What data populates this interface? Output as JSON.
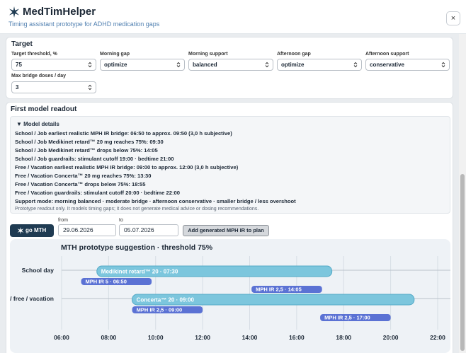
{
  "app": {
    "title": "MedTimHelper",
    "subtitle": "Timing assistant prototype for ADHD medication gaps",
    "close_label": "×"
  },
  "target": {
    "title": "Target",
    "fields": [
      {
        "label": "Target threshold, %",
        "value": "75"
      },
      {
        "label": "Morning gap",
        "value": "optimize"
      },
      {
        "label": "Morning support",
        "value": "balanced"
      },
      {
        "label": "Afternoon gap",
        "value": "optimize"
      },
      {
        "label": "Afternoon support",
        "value": "conservative"
      }
    ],
    "max_bridge": {
      "label": "Max bridge doses / day",
      "value": "3"
    }
  },
  "readout": {
    "title": "First model readout",
    "details_summary": "▼ Model details",
    "lines": [
      "School / Job earliest realistic MPH IR bridge: 06:50 to approx. 09:50 (3,0 h subjective)",
      "School / Job Medikinet retard™ 20 mg reaches 75%: 09:30",
      "School / Job Medikinet retard™ drops below 75%: 14:05",
      "School / Job guardrails: stimulant cutoff 19:00 · bedtime 21:00",
      "Free / Vacation earliest realistic MPH IR bridge: 09:00 to approx. 12:00 (3,0 h subjective)",
      "Free / Vacation Concerta™ 20 mg reaches 75%: 13:30",
      "Free / Vacation Concerta™ drops below 75%: 18:55",
      "Free / Vacation guardrails: stimulant cutoff 20:00 · bedtime 22:00",
      "Support mode: morning balanced · moderate bridge · afternoon conservative · smaller bridge / less overshoot"
    ],
    "note": "Prototype readout only. It models timing gaps; it does not generate medical advice or dosing recommendations."
  },
  "actions": {
    "go_label": "go MTH",
    "from_label": "from",
    "from_value": "29.06.2026",
    "to_label": "to",
    "to_value": "05.07.2026",
    "add_label": "Add generated MPH IR to plan"
  },
  "chart_data": {
    "type": "timeline",
    "title": "MTH prototype suggestion · threshold 75%",
    "rows": [
      "School day",
      "/ free / vacation"
    ],
    "x_ticks": [
      "06:00",
      "08:00",
      "10:00",
      "12:00",
      "14:00",
      "16:00",
      "18:00",
      "20:00",
      "22:00"
    ],
    "x_range_hours": [
      6,
      22
    ],
    "bars": [
      {
        "row": 0,
        "label": "Medikinet retard™ 20 · 07:30",
        "start": 7.5,
        "end": 17.5,
        "kind": "retard"
      },
      {
        "row": 0,
        "label": "MPH IR 5 · 06:50",
        "start": 6.83,
        "end": 9.83,
        "kind": "ir"
      },
      {
        "row": 0,
        "label": "MPH IR 2,5 · 14:05",
        "start": 14.08,
        "end": 17.08,
        "kind": "ir"
      },
      {
        "row": 1,
        "label": "Concerta™ 20 · 09:00",
        "start": 9.0,
        "end": 21.0,
        "kind": "retard"
      },
      {
        "row": 1,
        "label": "MPH IR 2,5 · 09:00",
        "start": 9.0,
        "end": 12.0,
        "kind": "ir"
      },
      {
        "row": 1,
        "label": "MPH IR 2,5 · 17:00",
        "start": 17.0,
        "end": 20.0,
        "kind": "ir"
      }
    ],
    "colors": {
      "retard": "#7cc6dd",
      "retard_border": "#53a9c6",
      "ir": "#5b72d4"
    }
  }
}
